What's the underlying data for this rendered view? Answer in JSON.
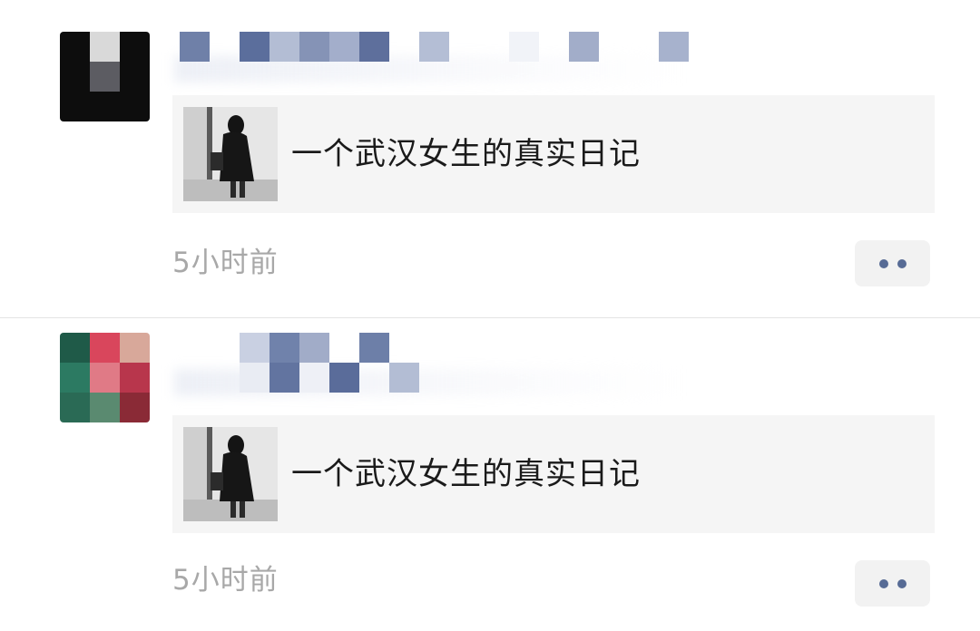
{
  "posts": [
    {
      "share_title": "一个武汉女生的真实日记",
      "timestamp": "5小时前",
      "more_icon": "more-dots-icon",
      "avatar_colors": [
        "#0d0d0d",
        "#d9d9d9",
        "#0d0d0d",
        "#0d0d0d",
        "#5c5c62",
        "#0d0d0d",
        "#0d0d0d",
        "#0d0d0d",
        "#0d0d0d"
      ]
    },
    {
      "share_title": "一个武汉女生的真实日记",
      "timestamp": "5小时前",
      "more_icon": "more-dots-icon",
      "avatar_colors": [
        "#1f5a48",
        "#d9465c",
        "#d8a89a",
        "#2c7a62",
        "#e07a86",
        "#b8364c",
        "#2a6a55",
        "#5a8a70",
        "#8a2a36"
      ]
    }
  ],
  "colors": {
    "link_blue": "#576b95",
    "card_bg": "#f5f5f5",
    "timestamp_gray": "#a8a8a8"
  }
}
